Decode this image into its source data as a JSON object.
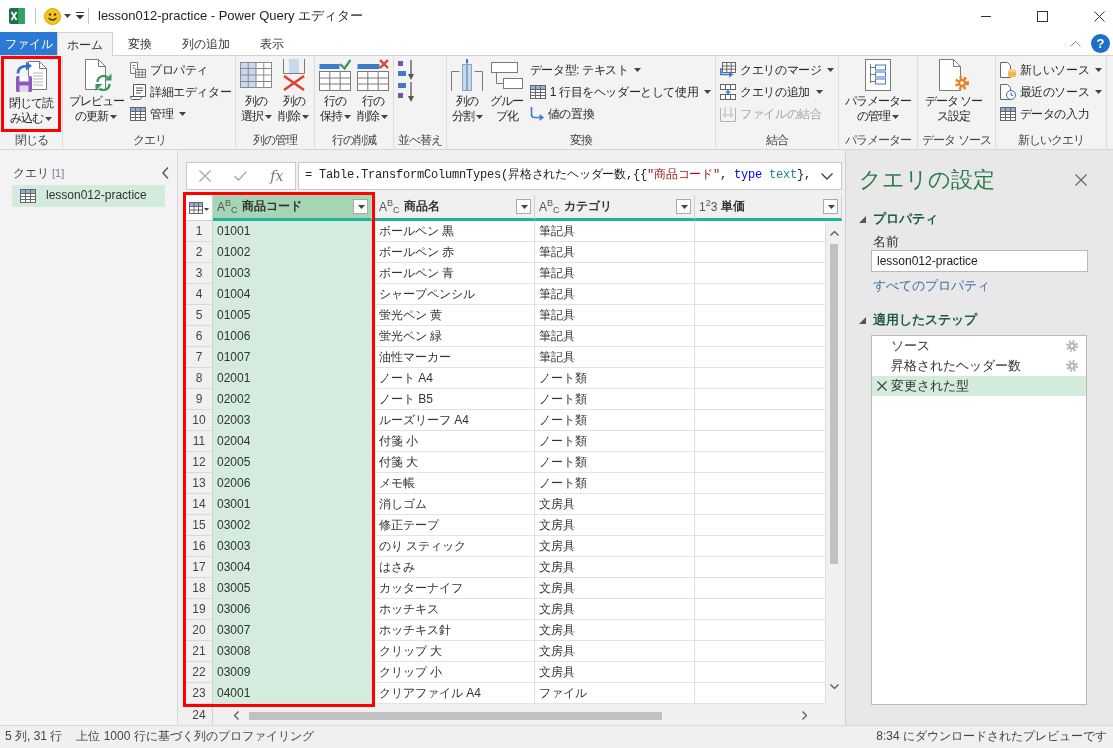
{
  "window": {
    "title": "lesson012-practice - Power Query エディター",
    "help_label": "?"
  },
  "ribbon_tabs": [
    {
      "label": "ファイル",
      "kind": "file",
      "selected": false
    },
    {
      "label": "ホーム",
      "kind": "tab",
      "selected": true
    },
    {
      "label": "変換",
      "kind": "tab",
      "selected": false
    },
    {
      "label": "列の追加",
      "kind": "tab",
      "selected": false
    },
    {
      "label": "表示",
      "kind": "tab",
      "selected": false
    }
  ],
  "ribbon_groups": [
    {
      "label": "閉じる",
      "items": [
        {
          "kind": "large",
          "label": "閉じて読み込む",
          "dropdown": true,
          "disabled": false,
          "highlighted": true
        }
      ]
    },
    {
      "label": "クエリ",
      "items": [
        {
          "kind": "large",
          "label": "プレビューの更新",
          "dropdown": true,
          "disabled": false,
          "highlighted": false
        },
        {
          "kind": "small",
          "label": "プロパティ",
          "dropdown": false,
          "disabled": false,
          "highlighted": false
        },
        {
          "kind": "small",
          "label": "詳細エディター",
          "dropdown": false,
          "disabled": false,
          "highlighted": false
        },
        {
          "kind": "small",
          "label": "管理",
          "dropdown": true,
          "disabled": false,
          "highlighted": false
        }
      ]
    },
    {
      "label": "列の管理",
      "items": [
        {
          "kind": "large",
          "label": "列の選択",
          "dropdown": true,
          "disabled": false,
          "highlighted": false
        },
        {
          "kind": "large",
          "label": "列の削除",
          "dropdown": true,
          "disabled": false,
          "highlighted": false
        }
      ]
    },
    {
      "label": "行の削減",
      "items": [
        {
          "kind": "large",
          "label": "行の保持",
          "dropdown": true,
          "disabled": false,
          "highlighted": false
        },
        {
          "kind": "large",
          "label": "行の削除",
          "dropdown": true,
          "disabled": false,
          "highlighted": false
        }
      ]
    },
    {
      "label": "並べ替え",
      "items": [
        {
          "kind": "icon",
          "dropdown": false,
          "disabled": false,
          "highlighted": false
        },
        {
          "kind": "icon",
          "dropdown": false,
          "disabled": false,
          "highlighted": false
        }
      ]
    },
    {
      "label": "変換",
      "items": [
        {
          "kind": "large",
          "label": "列の分割",
          "dropdown": true,
          "disabled": false,
          "highlighted": false
        },
        {
          "kind": "large",
          "label": "グループ化",
          "dropdown": false,
          "disabled": false,
          "highlighted": false
        },
        {
          "kind": "small",
          "label": "データ型: テキスト",
          "dropdown": true,
          "disabled": false,
          "highlighted": false
        },
        {
          "kind": "small",
          "label": "1 行目をヘッダーとして使用",
          "dropdown": true,
          "disabled": false,
          "highlighted": false
        },
        {
          "kind": "small",
          "label": "値の置換",
          "dropdown": false,
          "disabled": false,
          "highlighted": false
        }
      ]
    },
    {
      "label": "結合",
      "items": [
        {
          "kind": "small",
          "label": "クエリのマージ",
          "dropdown": true,
          "disabled": false,
          "highlighted": false
        },
        {
          "kind": "small",
          "label": "クエリの追加",
          "dropdown": true,
          "disabled": false,
          "highlighted": false
        },
        {
          "kind": "small",
          "label": "ファイルの結合",
          "dropdown": false,
          "disabled": true,
          "highlighted": false
        }
      ]
    },
    {
      "label": "パラメーター",
      "items": [
        {
          "kind": "large",
          "label": "パラメーターの管理",
          "dropdown": true,
          "disabled": false,
          "highlighted": false
        }
      ]
    },
    {
      "label": "データ ソース",
      "items": [
        {
          "kind": "large",
          "label": "データ ソース設定",
          "dropdown": false,
          "disabled": false,
          "highlighted": false
        }
      ]
    },
    {
      "label": "新しいクエリ",
      "items": [
        {
          "kind": "small",
          "label": "新しいソース",
          "dropdown": true,
          "disabled": false,
          "highlighted": false
        },
        {
          "kind": "small",
          "label": "最近のソース",
          "dropdown": true,
          "disabled": false,
          "highlighted": false
        },
        {
          "kind": "small",
          "label": "データの入力",
          "dropdown": false,
          "disabled": false,
          "highlighted": false
        }
      ]
    }
  ],
  "queries_pane": {
    "title": "クエリ",
    "count": "[1]",
    "items": [
      {
        "label": "lesson012-practice",
        "selected": true
      }
    ]
  },
  "formula_bar": {
    "fx_label": "fx",
    "tokens": [
      {
        "kind": "plain",
        "text": "= Table.TransformColumnTypes(昇格されたヘッダー数,{{"
      },
      {
        "kind": "string",
        "text": "\"商品コード\""
      },
      {
        "kind": "plain",
        "text": ", "
      },
      {
        "kind": "keyword",
        "text": "type"
      },
      {
        "kind": "type",
        "text": " text"
      },
      {
        "kind": "plain",
        "text": "},"
      }
    ]
  },
  "table": {
    "columns": [
      {
        "name": "商品コード",
        "type": "A$^{B}$$_{C}$",
        "selected": true,
        "highlighted": true
      },
      {
        "name": "商品名",
        "type": "A$^{B}$$_{C}$",
        "selected": false,
        "highlighted": false
      },
      {
        "name": "カテゴリ",
        "type": "A$^{B}$$_{C}$",
        "selected": false,
        "highlighted": false
      },
      {
        "name": "単価",
        "type": "1$^{2}$3",
        "selected": false,
        "highlighted": false
      }
    ],
    "rows": [
      {
        "number": "1",
        "cells": [
          "01001",
          "ボールペン 黒",
          "筆記具"
        ]
      },
      {
        "number": "2",
        "cells": [
          "01002",
          "ボールペン 赤",
          "筆記具"
        ]
      },
      {
        "number": "3",
        "cells": [
          "01003",
          "ボールペン 青",
          "筆記具"
        ]
      },
      {
        "number": "4",
        "cells": [
          "01004",
          "シャープペンシル",
          "筆記具"
        ]
      },
      {
        "number": "5",
        "cells": [
          "01005",
          "蛍光ペン 黄",
          "筆記具"
        ]
      },
      {
        "number": "6",
        "cells": [
          "01006",
          "蛍光ペン 緑",
          "筆記具"
        ]
      },
      {
        "number": "7",
        "cells": [
          "01007",
          "油性マーカー",
          "筆記具"
        ]
      },
      {
        "number": "8",
        "cells": [
          "02001",
          "ノート A4",
          "ノート類"
        ]
      },
      {
        "number": "9",
        "cells": [
          "02002",
          "ノート B5",
          "ノート類"
        ]
      },
      {
        "number": "10",
        "cells": [
          "02003",
          "ルーズリーフ A4",
          "ノート類"
        ]
      },
      {
        "number": "11",
        "cells": [
          "02004",
          "付箋 小",
          "ノート類"
        ]
      },
      {
        "number": "12",
        "cells": [
          "02005",
          "付箋 大",
          "ノート類"
        ]
      },
      {
        "number": "13",
        "cells": [
          "02006",
          "メモ帳",
          "ノート類"
        ]
      },
      {
        "number": "14",
        "cells": [
          "03001",
          "消しゴム",
          "文房具"
        ]
      },
      {
        "number": "15",
        "cells": [
          "03002",
          "修正テープ",
          "文房具"
        ]
      },
      {
        "number": "16",
        "cells": [
          "03003",
          "のり スティック",
          "文房具"
        ]
      },
      {
        "number": "17",
        "cells": [
          "03004",
          "はさみ",
          "文房具"
        ]
      },
      {
        "number": "18",
        "cells": [
          "03005",
          "カッターナイフ",
          "文房具"
        ]
      },
      {
        "number": "19",
        "cells": [
          "03006",
          "ホッチキス",
          "文房具"
        ]
      },
      {
        "number": "20",
        "cells": [
          "03007",
          "ホッチキス針",
          "文房具"
        ]
      },
      {
        "number": "21",
        "cells": [
          "03008",
          "クリップ 大",
          "文房具"
        ]
      },
      {
        "number": "22",
        "cells": [
          "03009",
          "クリップ 小",
          "文房具"
        ]
      },
      {
        "number": "23",
        "cells": [
          "04001",
          "クリアファイル A4",
          "ファイル"
        ]
      }
    ],
    "partial_row": {
      "number": "24"
    }
  },
  "query_settings": {
    "title": "クエリの設定",
    "properties": {
      "heading": "プロパティ",
      "expanded": true,
      "name_label": "名前",
      "name_value": "lesson012-practice",
      "link": "すべてのプロパティ"
    },
    "applied_steps": {
      "heading": "適用したステップ",
      "expanded": true,
      "steps": [
        {
          "label": "ソース",
          "selected": false,
          "settings": true
        },
        {
          "label": "昇格されたヘッダー数",
          "selected": false,
          "settings": true
        },
        {
          "label": "変更された型",
          "selected": true,
          "settings": false
        }
      ]
    }
  },
  "status_bar": {
    "left": [
      "5 列, 31 行",
      "上位 1000 行に基づく列のプロファイリング"
    ],
    "right": "8:34 にダウンロードされたプレビューです"
  }
}
